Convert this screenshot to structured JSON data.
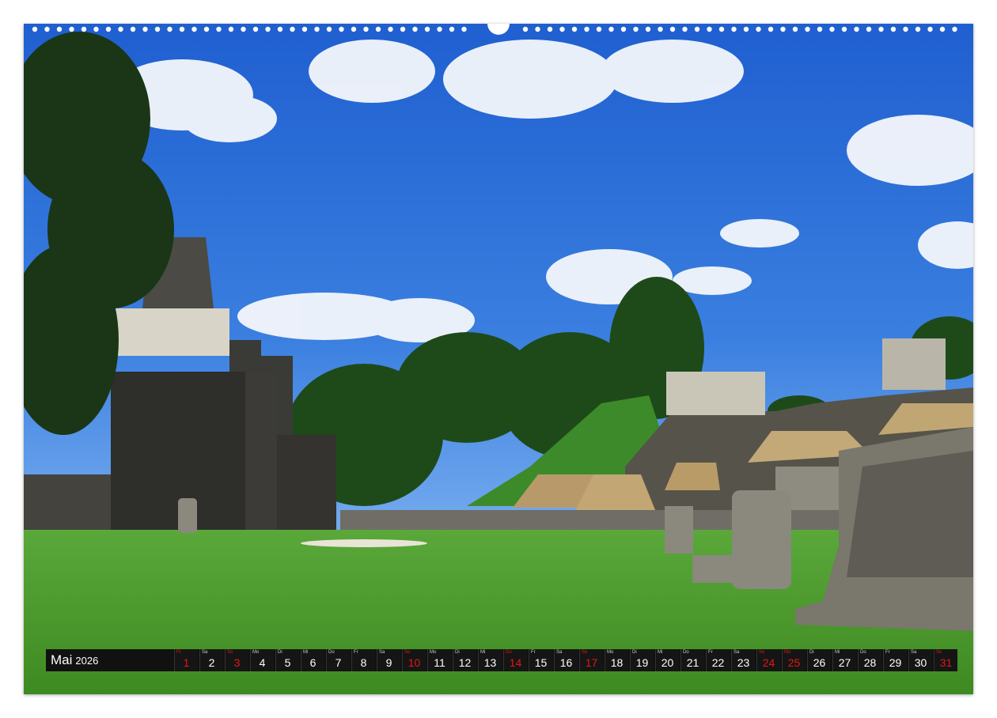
{
  "calendar": {
    "month": "Mai",
    "year": "2026",
    "highlight_color": "#e01818",
    "days": [
      {
        "wd": "Fr",
        "num": "1",
        "red": true
      },
      {
        "wd": "Sa",
        "num": "2",
        "red": false
      },
      {
        "wd": "So",
        "num": "3",
        "red": true
      },
      {
        "wd": "Mo",
        "num": "4",
        "red": false
      },
      {
        "wd": "Di",
        "num": "5",
        "red": false
      },
      {
        "wd": "Mi",
        "num": "6",
        "red": false
      },
      {
        "wd": "Do",
        "num": "7",
        "red": false
      },
      {
        "wd": "Fr",
        "num": "8",
        "red": false
      },
      {
        "wd": "Sa",
        "num": "9",
        "red": false
      },
      {
        "wd": "So",
        "num": "10",
        "red": true
      },
      {
        "wd": "Mo",
        "num": "11",
        "red": false
      },
      {
        "wd": "Di",
        "num": "12",
        "red": false
      },
      {
        "wd": "Mi",
        "num": "13",
        "red": false
      },
      {
        "wd": "Do",
        "num": "14",
        "red": true
      },
      {
        "wd": "Fr",
        "num": "15",
        "red": false
      },
      {
        "wd": "Sa",
        "num": "16",
        "red": false
      },
      {
        "wd": "So",
        "num": "17",
        "red": true
      },
      {
        "wd": "Mo",
        "num": "18",
        "red": false
      },
      {
        "wd": "Di",
        "num": "19",
        "red": false
      },
      {
        "wd": "Mi",
        "num": "20",
        "red": false
      },
      {
        "wd": "Do",
        "num": "21",
        "red": false
      },
      {
        "wd": "Fr",
        "num": "22",
        "red": false
      },
      {
        "wd": "Sa",
        "num": "23",
        "red": false
      },
      {
        "wd": "So",
        "num": "24",
        "red": true
      },
      {
        "wd": "Mo",
        "num": "25",
        "red": true
      },
      {
        "wd": "Di",
        "num": "26",
        "red": false
      },
      {
        "wd": "Mi",
        "num": "27",
        "red": false
      },
      {
        "wd": "Do",
        "num": "28",
        "red": false
      },
      {
        "wd": "Fr",
        "num": "29",
        "red": false
      },
      {
        "wd": "Sa",
        "num": "30",
        "red": false
      },
      {
        "wd": "So",
        "num": "31",
        "red": true
      }
    ]
  },
  "photo": {
    "subject": "maya-temple-ruins-plaza",
    "sky_color": "#2f6fd6",
    "grass_color": "#4a9a2a"
  }
}
